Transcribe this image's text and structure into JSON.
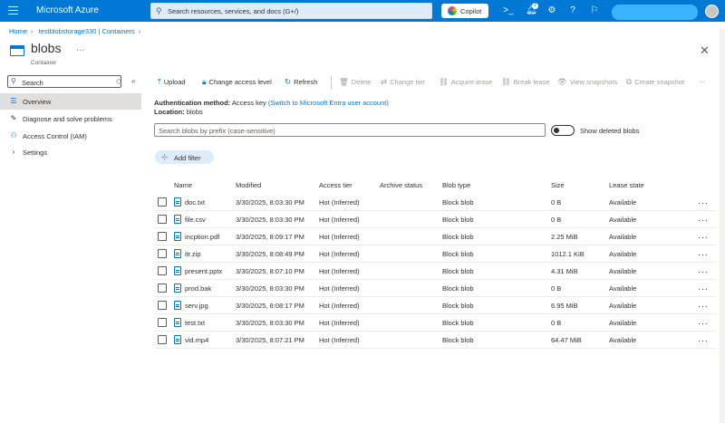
{
  "topbar": {
    "brand": "Microsoft Azure",
    "search_placeholder": "Search resources, services, and docs (G+/)",
    "copilot_label": "Copilot",
    "notification_count": "7"
  },
  "breadcrumb": [
    "Home",
    "testblobstorage330 | Containers"
  ],
  "header": {
    "title": "blobs",
    "subtitle": "Container"
  },
  "sidebar": {
    "search_placeholder": "Search",
    "items": [
      {
        "label": "Overview",
        "icon": "overview-icon",
        "active": true
      },
      {
        "label": "Diagnose and solve problems",
        "icon": "wrench-icon"
      },
      {
        "label": "Access Control (IAM)",
        "icon": "people-icon"
      },
      {
        "label": "Settings",
        "icon": "chevron-right-icon"
      }
    ]
  },
  "toolbar": {
    "upload": "Upload",
    "change_access_level": "Change access level",
    "refresh": "Refresh",
    "delete": "Delete",
    "change_tier": "Change tier",
    "acquire_lease": "Acquire lease",
    "break_lease": "Break lease",
    "view_snapshots": "View snapshots",
    "create_snapshot": "Create snapshot"
  },
  "info": {
    "auth_label": "Authentication method:",
    "auth_value": "Access key",
    "auth_link": "(Switch to Microsoft Entra user account)",
    "location_label": "Location:",
    "location_value": "blobs"
  },
  "filters": {
    "blob_search_placeholder": "Search blobs by prefix (case-sensitive)",
    "show_deleted": "Show deleted blobs",
    "add_filter": "Add filter"
  },
  "table": {
    "columns": [
      "Name",
      "Modified",
      "Access tier",
      "Archive status",
      "Blob type",
      "Size",
      "Lease state"
    ],
    "rows": [
      {
        "name": "doc.txt",
        "modified": "3/30/2025, 8:03:30 PM",
        "tier": "Hot (Inferred)",
        "archive": "",
        "type": "Block blob",
        "size": "0 B",
        "lease": "Available"
      },
      {
        "name": "file.csv",
        "modified": "3/30/2025, 8:03:30 PM",
        "tier": "Hot (Inferred)",
        "archive": "",
        "type": "Block blob",
        "size": "0 B",
        "lease": "Available"
      },
      {
        "name": "incption.pdf",
        "modified": "3/30/2025, 8:09:17 PM",
        "tier": "Hot (Inferred)",
        "archive": "",
        "type": "Block blob",
        "size": "2.25 MiB",
        "lease": "Available"
      },
      {
        "name": "itr.zip",
        "modified": "3/30/2025, 8:08:49 PM",
        "tier": "Hot (Inferred)",
        "archive": "",
        "type": "Block blob",
        "size": "1012.1 KiB",
        "lease": "Available"
      },
      {
        "name": "present.pptx",
        "modified": "3/30/2025, 8:07:10 PM",
        "tier": "Hot (Inferred)",
        "archive": "",
        "type": "Block blob",
        "size": "4.31 MiB",
        "lease": "Available"
      },
      {
        "name": "prod.bak",
        "modified": "3/30/2025, 8:03:30 PM",
        "tier": "Hot (Inferred)",
        "archive": "",
        "type": "Block blob",
        "size": "0 B",
        "lease": "Available"
      },
      {
        "name": "serv.jpg",
        "modified": "3/30/2025, 8:08:17 PM",
        "tier": "Hot (Inferred)",
        "archive": "",
        "type": "Block blob",
        "size": "6.95 MiB",
        "lease": "Available"
      },
      {
        "name": "test.txt",
        "modified": "3/30/2025, 8:03:30 PM",
        "tier": "Hot (Inferred)",
        "archive": "",
        "type": "Block blob",
        "size": "0 B",
        "lease": "Available"
      },
      {
        "name": "vid.mp4",
        "modified": "3/30/2025, 8:07:21 PM",
        "tier": "Hot (Inferred)",
        "archive": "",
        "type": "Block blob",
        "size": "64.47 MiB",
        "lease": "Available"
      }
    ]
  },
  "colors": {
    "accent": "#0078d4",
    "active_bg": "#e1dfdd"
  }
}
